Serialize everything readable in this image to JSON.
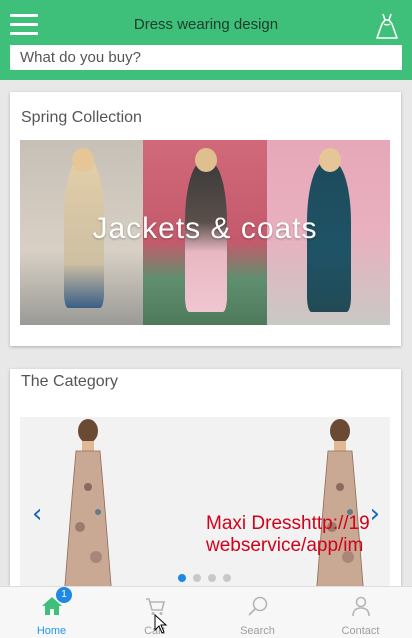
{
  "header": {
    "title": "Dress wearing design",
    "search_placeholder": "What do you buy?",
    "menu_icon": "hamburger-icon",
    "brand_icon": "dress-icon",
    "color": "#3fc07a"
  },
  "spring": {
    "title": "Spring Collection",
    "banner_text": "Jackets & coats"
  },
  "category": {
    "title": "The Category",
    "caption_line1": "Maxi Dresshttp://19",
    "caption_line2": "webservice/app/im",
    "prev_icon": "‹",
    "next_icon": "›",
    "slide_count": 4,
    "active_slide": 1
  },
  "tabs": [
    {
      "label": "Home",
      "icon": "home-icon",
      "badge": "1",
      "active": true
    },
    {
      "label": "Cart",
      "icon": "cart-icon",
      "active": false
    },
    {
      "label": "Search",
      "icon": "search-icon",
      "active": false
    },
    {
      "label": "Contact",
      "icon": "person-icon",
      "active": false
    }
  ],
  "colors": {
    "accent": "#3fc07a",
    "active_tab": "#2196f3",
    "caption": "#d0021b"
  }
}
